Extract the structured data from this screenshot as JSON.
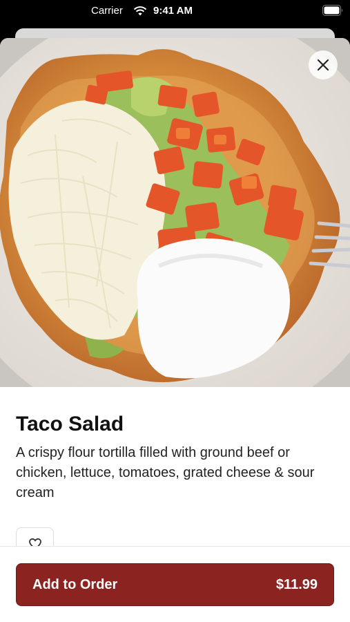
{
  "status_bar": {
    "carrier": "Carrier",
    "time": "9:41 AM"
  },
  "item": {
    "title": "Taco Salad",
    "description": "A crispy flour tortilla filled with ground beef or chicken, lettuce, tomatoes, grated cheese & sour cream",
    "image_alt": "Taco Salad"
  },
  "order_button": {
    "label": "Add to Order",
    "price": "$11.99"
  },
  "colors": {
    "accent": "#8b2320",
    "background": "#ffffff"
  }
}
